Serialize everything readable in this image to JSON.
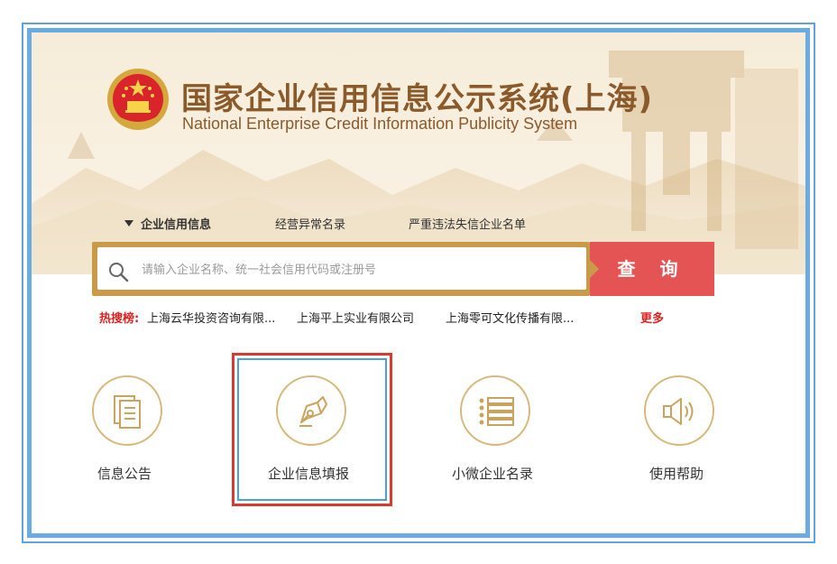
{
  "header": {
    "title_cn": "国家企业信用信息公示系统(上海)",
    "title_en": "National Enterprise Credit Information Publicity System",
    "emblem_icon": "national-emblem-icon"
  },
  "nav": {
    "items": [
      {
        "label": "企业信用信息",
        "active": true
      },
      {
        "label": "经营异常名录",
        "active": false
      },
      {
        "label": "严重违法失信企业名单",
        "active": false
      }
    ]
  },
  "search": {
    "placeholder": "请输入企业名称、统一社会信用代码或注册号",
    "value": "",
    "button_label": "查 询",
    "icon": "search-icon"
  },
  "hot_search": {
    "label": "热搜榜:",
    "items": [
      "上海云华投资咨询有限...",
      "上海平上实业有限公司",
      "上海零可文化传播有限..."
    ],
    "more_label": "更多"
  },
  "tiles": [
    {
      "label": "信息公告",
      "icon": "document-icon"
    },
    {
      "label": "企业信息填报",
      "icon": "pen-nib-icon"
    },
    {
      "label": "小微企业名录",
      "icon": "list-icon"
    },
    {
      "label": "使用帮助",
      "icon": "speaker-icon"
    }
  ],
  "colors": {
    "title": "#8b5a2b",
    "accent_red": "#e55454",
    "gold": "#c99a4a",
    "frame_blue": "#6aabe2"
  }
}
